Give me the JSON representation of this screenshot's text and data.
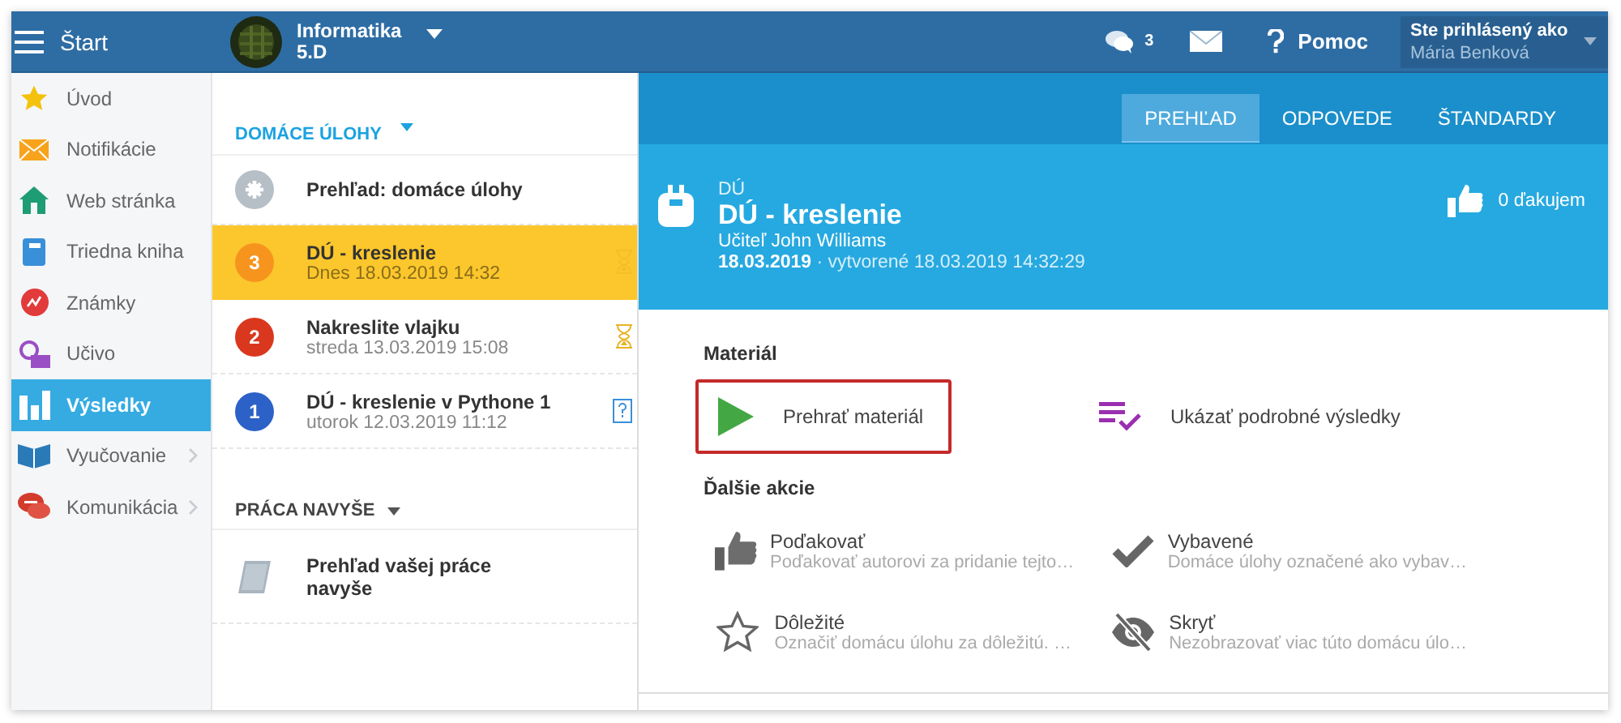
{
  "header": {
    "menu_label": "Štart",
    "course": {
      "name": "Informatika",
      "class_name": "5.D"
    },
    "messages_count": "3",
    "help": "Pomoc",
    "user": {
      "label": "Ste prihlásený ako",
      "name": "Mária Benková"
    }
  },
  "sidebar": {
    "items": [
      {
        "label": "Úvod",
        "kind": "star",
        "selected": false,
        "has_submenu": false
      },
      {
        "label": "Notifikácie",
        "kind": "mail",
        "selected": false,
        "has_submenu": false
      },
      {
        "label": "Web stránka",
        "kind": "house",
        "selected": false,
        "has_submenu": false
      },
      {
        "label": "Triedna kniha",
        "kind": "book",
        "selected": false,
        "has_submenu": false
      },
      {
        "label": "Známky",
        "kind": "grades",
        "selected": false,
        "has_submenu": false
      },
      {
        "label": "Učivo",
        "kind": "lesson",
        "selected": false,
        "has_submenu": false
      },
      {
        "label": "Výsledky",
        "kind": "chart",
        "selected": true,
        "has_submenu": false
      },
      {
        "label": "Vyučovanie",
        "kind": "openbook",
        "selected": false,
        "has_submenu": true
      },
      {
        "label": "Komunikácia",
        "kind": "chat",
        "selected": false,
        "has_submenu": true
      }
    ]
  },
  "homework": {
    "heading": "DOMÁCE ÚLOHY",
    "items": [
      {
        "kind": "overview",
        "title": "Prehľad: domáce úlohy",
        "selected": false
      },
      {
        "kind": "pending",
        "badge": "3",
        "color": "#f7941d",
        "title": "DÚ - kreslenie",
        "date": "Dnes 18.03.2019 14:32",
        "selected": true
      },
      {
        "kind": "pending",
        "badge": "2",
        "color": "#d9381e",
        "title": "Nakreslite vlajku",
        "date": "streda 13.03.2019 15:08",
        "selected": false
      },
      {
        "kind": "unanswered",
        "badge": "1",
        "color": "#2c62c8",
        "title": "DÚ - kreslenie v Pythone 1",
        "date": "utorok 12.03.2019 11:12",
        "selected": false
      }
    ]
  },
  "extra_work": {
    "heading": "PRÁCA NAVYŠE",
    "items": [
      {
        "title": "Prehľad vašej práce navyše"
      }
    ]
  },
  "detail": {
    "tabs": [
      {
        "label": "PREHĽAD",
        "selected": true
      },
      {
        "label": "ODPOVEDE",
        "selected": false
      },
      {
        "label": "ŠTANDARDY",
        "selected": false
      }
    ],
    "type_label": "DÚ",
    "title": "DÚ - kreslenie",
    "teacher": "Učiteľ John Williams",
    "date": "18.03.2019",
    "created": "· vytvorené 18.03.2019 14:32:29",
    "thanks": "0 ďakujem",
    "material": {
      "heading": "Materiál",
      "actions": [
        {
          "kind": "play",
          "label": "Prehrať materiál",
          "highlighted": true
        },
        {
          "kind": "results",
          "label": "Ukázať podrobné výsledky",
          "highlighted": false
        }
      ]
    },
    "more": {
      "heading": "Ďalšie akcie",
      "actions": [
        {
          "kind": "thumb",
          "title": "Poďakovať",
          "description": "Poďakovať autorovi za pridanie tejto…"
        },
        {
          "kind": "check",
          "title": "Vybavené",
          "description": "Domáce úlohy označené ako vybav…"
        },
        {
          "kind": "star",
          "title": "Dôležité",
          "description": "Označiť domácu úlohu za dôležitú. …"
        },
        {
          "kind": "hide",
          "title": "Skryť",
          "description": "Nezobrazovať viac túto domácu úlo…"
        }
      ]
    }
  }
}
